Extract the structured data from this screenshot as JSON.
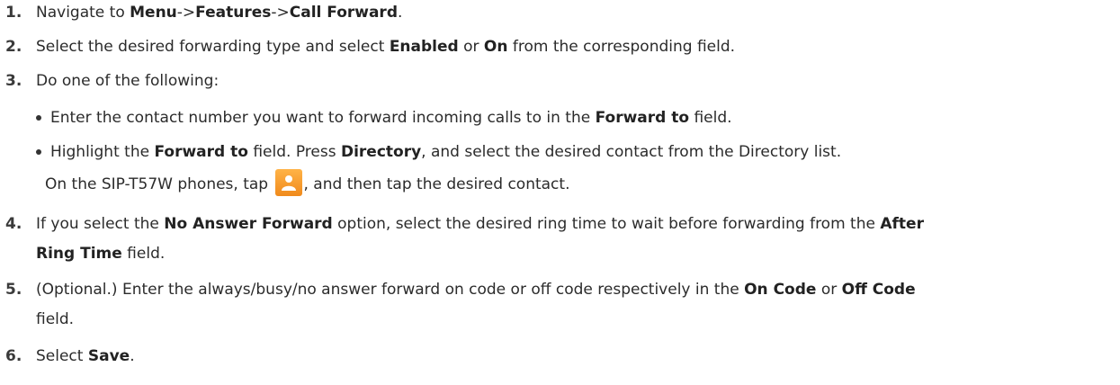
{
  "steps": [
    {
      "num": "1.",
      "parts": [
        "Navigate to ",
        "Menu",
        "->",
        "Features",
        "->",
        "Call Forward",
        "."
      ]
    },
    {
      "num": "2.",
      "parts": [
        "Select the desired forwarding type and select ",
        "Enabled",
        " or ",
        "On",
        " from the corresponding field."
      ]
    },
    {
      "num": "3.",
      "parts": [
        "Do one of the following:"
      ]
    },
    {
      "num": "4.",
      "line1": [
        "If you select the ",
        "No Answer Forward",
        " option, select the desired ring time to wait before forwarding from the ",
        "After"
      ],
      "line2": [
        "Ring Time",
        " field."
      ]
    },
    {
      "num": "5.",
      "line1": [
        "(Optional.) Enter the always/busy/no answer forward on code or off code respectively in the ",
        "On Code",
        " or ",
        "Off Code"
      ],
      "line2": [
        "field."
      ]
    },
    {
      "num": "6.",
      "parts": [
        "Select ",
        "Save",
        "."
      ]
    }
  ],
  "bullets": [
    {
      "parts": [
        "Enter the contact number you want to forward incoming calls to in the ",
        "Forward to",
        " field."
      ]
    },
    {
      "parts": [
        "Highlight the ",
        "Forward to",
        " field. Press ",
        "Directory",
        ", and select the desired contact from the Directory list."
      ],
      "line2_before": "On the SIP-T57W phones, tap ",
      "line2_after": ", and then tap the desired contact."
    }
  ],
  "icons": {
    "contact": "contact-person-icon",
    "contact_color": "#f39a2b"
  }
}
